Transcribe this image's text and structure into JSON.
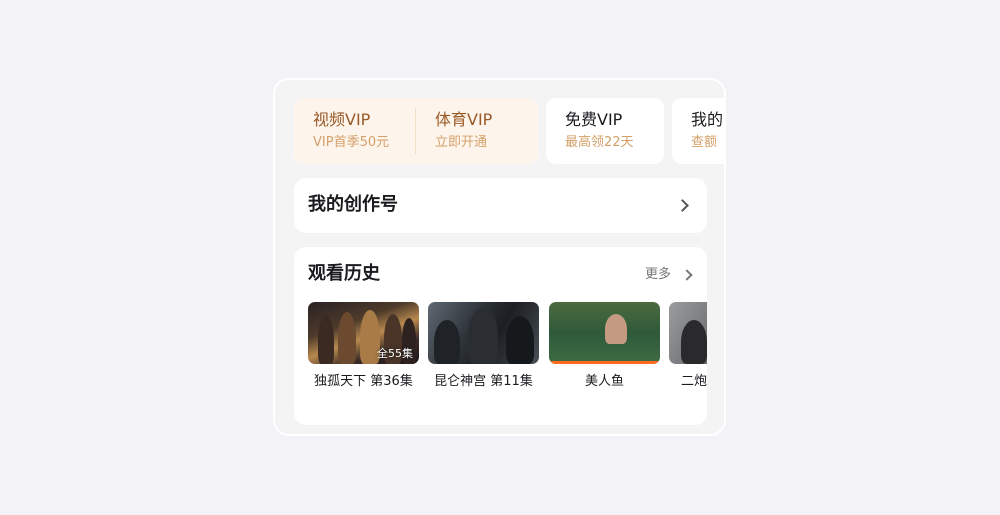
{
  "vip": {
    "video": {
      "title": "视频VIP",
      "subtitle": "VIP首季50元"
    },
    "sports": {
      "title": "体育VIP",
      "subtitle": "立即开通"
    },
    "free": {
      "title": "免费VIP",
      "subtitle": "最高领22天"
    },
    "mine": {
      "title": "我的",
      "subtitle": "查额"
    }
  },
  "creator": {
    "label": "我的创作号"
  },
  "history": {
    "title": "观看历史",
    "more_label": "更多",
    "items": [
      {
        "title": "独孤天下  第36集",
        "badge": "全55集"
      },
      {
        "title": "昆仑神宫  第11集"
      },
      {
        "title": "美人鱼",
        "progress": 1.0
      },
      {
        "title": "二炮"
      }
    ]
  },
  "colors": {
    "vip_gold_title": "#9a5a28",
    "vip_gold_sub": "#d4a06a",
    "vip_bg": "#fdf5ec",
    "progress": "#ff6a1e"
  }
}
